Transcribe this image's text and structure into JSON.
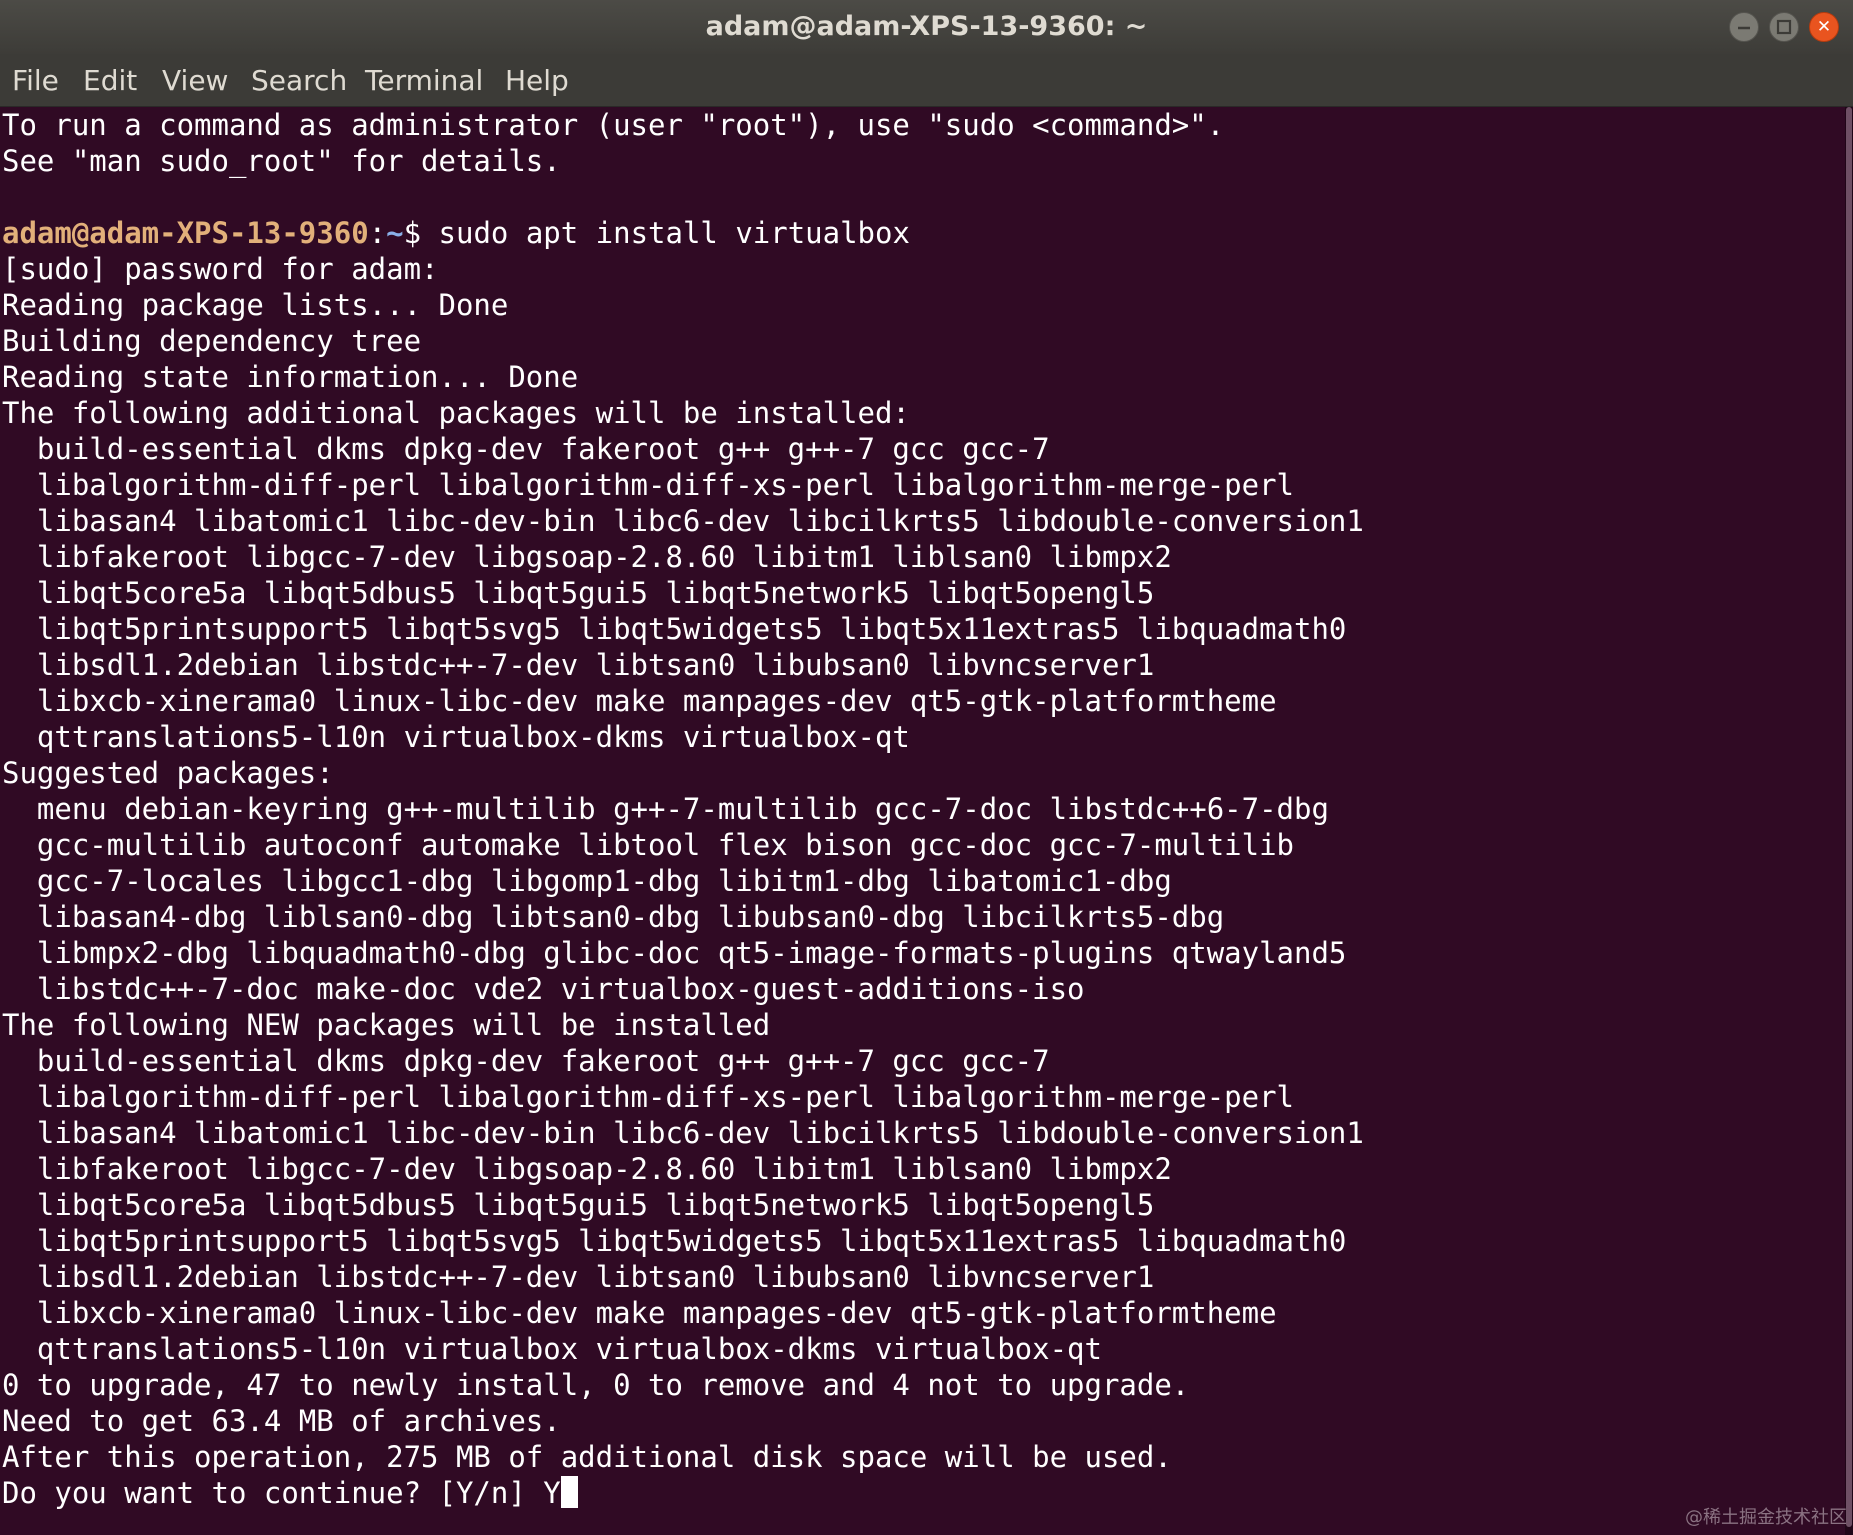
{
  "window": {
    "title": "adam@adam-XPS-13-9360: ~",
    "controls": {
      "minimize_icon": "minimize-icon",
      "maximize_icon": "maximize-icon",
      "close_icon": "close-icon",
      "close_glyph": "✕"
    }
  },
  "menubar": {
    "items": [
      "File",
      "Edit",
      "View",
      "Search",
      "Terminal",
      "Help"
    ]
  },
  "terminal": {
    "colors": {
      "background": "#300a24",
      "text": "#ffffff",
      "prompt_user": "#e2b07a",
      "prompt_path": "#8ab0e8"
    },
    "prompt": {
      "user_host": "adam@adam-XPS-13-9360",
      "separator": ":",
      "path": "~",
      "symbol": "$",
      "command": " sudo apt install virtualbox"
    },
    "lines": [
      "To run a command as administrator (user \"root\"), use \"sudo <command>\".",
      "See \"man sudo_root\" for details.",
      "",
      "",
      "[sudo] password for adam:",
      "Reading package lists... Done",
      "Building dependency tree",
      "Reading state information... Done",
      "The following additional packages will be installed:",
      "  build-essential dkms dpkg-dev fakeroot g++ g++-7 gcc gcc-7",
      "  libalgorithm-diff-perl libalgorithm-diff-xs-perl libalgorithm-merge-perl",
      "  libasan4 libatomic1 libc-dev-bin libc6-dev libcilkrts5 libdouble-conversion1",
      "  libfakeroot libgcc-7-dev libgsoap-2.8.60 libitm1 liblsan0 libmpx2",
      "  libqt5core5a libqt5dbus5 libqt5gui5 libqt5network5 libqt5opengl5",
      "  libqt5printsupport5 libqt5svg5 libqt5widgets5 libqt5x11extras5 libquadmath0",
      "  libsdl1.2debian libstdc++-7-dev libtsan0 libubsan0 libvncserver1",
      "  libxcb-xinerama0 linux-libc-dev make manpages-dev qt5-gtk-platformtheme",
      "  qttranslations5-l10n virtualbox-dkms virtualbox-qt",
      "Suggested packages:",
      "  menu debian-keyring g++-multilib g++-7-multilib gcc-7-doc libstdc++6-7-dbg",
      "  gcc-multilib autoconf automake libtool flex bison gcc-doc gcc-7-multilib",
      "  gcc-7-locales libgcc1-dbg libgomp1-dbg libitm1-dbg libatomic1-dbg",
      "  libasan4-dbg liblsan0-dbg libtsan0-dbg libubsan0-dbg libcilkrts5-dbg",
      "  libmpx2-dbg libquadmath0-dbg glibc-doc qt5-image-formats-plugins qtwayland5",
      "  libstdc++-7-doc make-doc vde2 virtualbox-guest-additions-iso",
      "The following NEW packages will be installed",
      "  build-essential dkms dpkg-dev fakeroot g++ g++-7 gcc gcc-7",
      "  libalgorithm-diff-perl libalgorithm-diff-xs-perl libalgorithm-merge-perl",
      "  libasan4 libatomic1 libc-dev-bin libc6-dev libcilkrts5 libdouble-conversion1",
      "  libfakeroot libgcc-7-dev libgsoap-2.8.60 libitm1 liblsan0 libmpx2",
      "  libqt5core5a libqt5dbus5 libqt5gui5 libqt5network5 libqt5opengl5",
      "  libqt5printsupport5 libqt5svg5 libqt5widgets5 libqt5x11extras5 libquadmath0",
      "  libsdl1.2debian libstdc++-7-dev libtsan0 libubsan0 libvncserver1",
      "  libxcb-xinerama0 linux-libc-dev make manpages-dev qt5-gtk-platformtheme",
      "  qttranslations5-l10n virtualbox virtualbox-dkms virtualbox-qt",
      "0 to upgrade, 47 to newly install, 0 to remove and 4 not to upgrade.",
      "Need to get 63.4 MB of archives.",
      "After this operation, 275 MB of additional disk space will be used."
    ],
    "input_line": {
      "question": "Do you want to continue? [Y/n] ",
      "answer": "Y"
    }
  },
  "watermark": "@稀土掘金技术社区"
}
